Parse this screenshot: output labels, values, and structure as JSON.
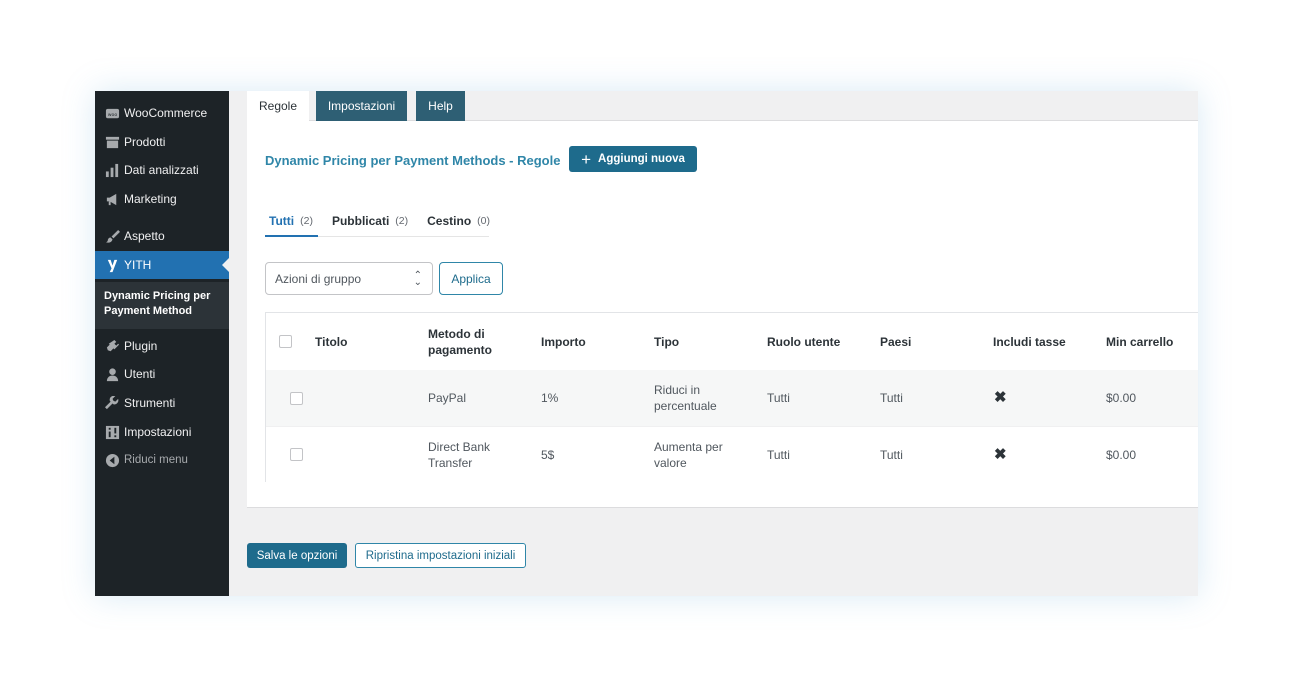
{
  "sidebar": {
    "items": [
      {
        "label": "WooCommerce",
        "icon": "woocommerce-icon"
      },
      {
        "label": "Prodotti",
        "icon": "products-icon"
      },
      {
        "label": "Dati analizzati",
        "icon": "bar-chart-icon"
      },
      {
        "label": "Marketing",
        "icon": "megaphone-icon"
      },
      {
        "label": "Aspetto",
        "icon": "paintbrush-icon"
      },
      {
        "label": "YITH",
        "icon": "yith-icon"
      },
      {
        "label": "Plugin",
        "icon": "plugin-icon"
      },
      {
        "label": "Utenti",
        "icon": "user-icon"
      },
      {
        "label": "Strumenti",
        "icon": "wrench-icon"
      },
      {
        "label": "Impostazioni",
        "icon": "settings-icon"
      },
      {
        "label": "Riduci menu",
        "icon": "collapse-icon"
      }
    ],
    "submenu_label": "Dynamic Pricing per Payment Method"
  },
  "tabs": [
    {
      "label": "Regole"
    },
    {
      "label": "Impostazioni"
    },
    {
      "label": "Help"
    }
  ],
  "page": {
    "title": "Dynamic Pricing per Payment Methods - Regole",
    "add_new_label": "Aggiungi nuova"
  },
  "filters": [
    {
      "label": "Tutti",
      "count": "(2)"
    },
    {
      "label": "Pubblicati",
      "count": "(2)"
    },
    {
      "label": "Cestino",
      "count": "(0)"
    }
  ],
  "bulk": {
    "selected": "Azioni di gruppo",
    "apply_label": "Applica"
  },
  "table": {
    "columns": [
      "Titolo",
      "Metodo di pagamento",
      "Importo",
      "Tipo",
      "Ruolo utente",
      "Paesi",
      "Includi tasse",
      "Min carrello"
    ],
    "rows": [
      {
        "title": "",
        "method": "PayPal",
        "amount": "1%",
        "type": "Riduci in percentuale",
        "role": "Tutti",
        "countries": "Tutti",
        "tax": "cross-icon",
        "min_cart": "$0.00"
      },
      {
        "title": "",
        "method": "Direct Bank Transfer",
        "amount": "5$",
        "type": "Aumenta per valore",
        "role": "Tutti",
        "countries": "Tutti",
        "tax": "cross-icon",
        "min_cart": "$0.00"
      }
    ]
  },
  "footer": {
    "save_label": "Salva le opzioni",
    "reset_label": "Ripristina impostazioni iniziali"
  },
  "colors": {
    "sidebar_bg": "#1d2327",
    "active_menu": "#2271b1",
    "primary_button": "#1e6b8c",
    "title_color": "#2f86a8",
    "dark_tab": "#2e5f74"
  }
}
